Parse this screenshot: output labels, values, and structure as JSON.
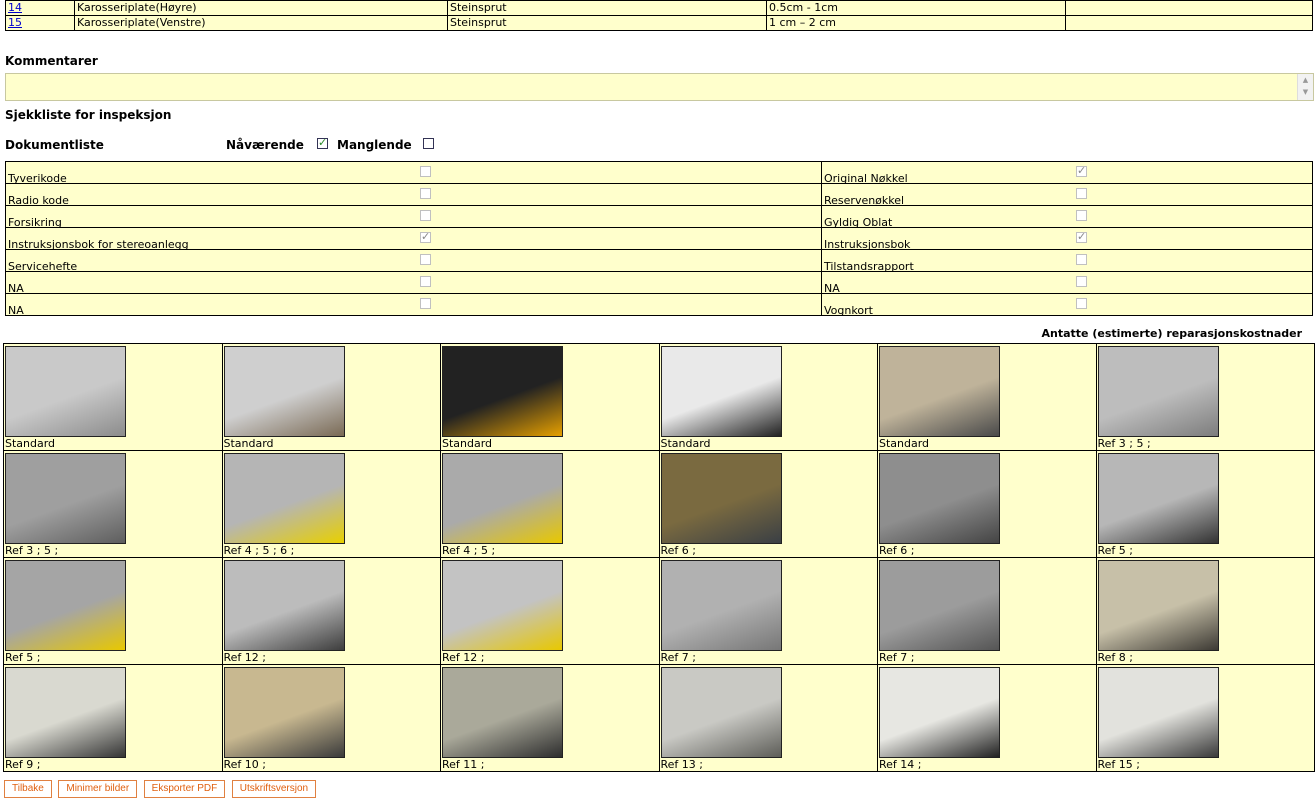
{
  "damage_rows": [
    {
      "ref": "14",
      "part": "Karosseriplate(Høyre)",
      "type": "Steinsprut",
      "size": "0.5cm - 1cm",
      "extra": ""
    },
    {
      "ref": "15",
      "part": "Karosseriplate(Venstre)",
      "type": "Steinsprut",
      "size": "1 cm – 2 cm",
      "extra": ""
    }
  ],
  "comments": {
    "heading": "Kommentarer",
    "value": ""
  },
  "checklist_heading": "Sjekkliste for inspeksjon",
  "doclist": {
    "heading": "Dokumentliste",
    "present_label": "Nåværende",
    "missing_label": "Manglende",
    "left": [
      {
        "label": "Tyverikode",
        "checked": false
      },
      {
        "label": "Radio kode",
        "checked": false
      },
      {
        "label": "Forsikring",
        "checked": false
      },
      {
        "label": "Instruksjonsbok for stereoanlegg",
        "checked": true
      },
      {
        "label": "Servicehefte",
        "checked": false
      },
      {
        "label": "NA",
        "checked": false
      },
      {
        "label": "NA",
        "checked": false
      }
    ],
    "right": [
      {
        "label": "Original Nøkkel",
        "checked": true
      },
      {
        "label": "Reservenøkkel",
        "checked": false
      },
      {
        "label": "Gyldig Oblat",
        "checked": false
      },
      {
        "label": "Instruksjonsbok",
        "checked": true
      },
      {
        "label": "Tilstandsrapport",
        "checked": false
      },
      {
        "label": "NA",
        "checked": false
      },
      {
        "label": "Vognkort",
        "checked": false
      }
    ]
  },
  "estimate_label": "Antatte (estimerte) reparasjonskostnader",
  "photos": [
    [
      "Standard",
      "Standard",
      "Standard",
      "Standard",
      "Standard",
      "Ref 3 ; 5 ;"
    ],
    [
      "Ref 3 ; 5 ;",
      "Ref 4 ; 5 ; 6 ;",
      "Ref 4 ; 5 ;",
      "Ref 6 ;",
      "Ref 6 ;",
      "Ref 5 ;"
    ],
    [
      "Ref 5 ;",
      "Ref 12 ;",
      "Ref 12 ;",
      "Ref 7 ;",
      "Ref 7 ;",
      "Ref 8 ;"
    ],
    [
      "Ref 9 ;",
      "Ref 10 ;",
      "Ref 11 ;",
      "Ref 13 ;",
      "Ref 14 ;",
      "Ref 15 ;"
    ]
  ],
  "buttons": [
    "Tilbake",
    "Minimer bilder",
    "Eksporter PDF",
    "Utskriftsversjon"
  ]
}
